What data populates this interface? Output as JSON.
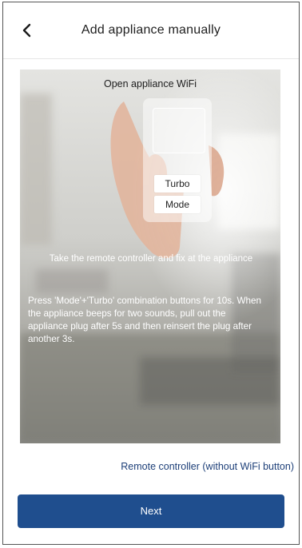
{
  "header": {
    "title": "Add appliance manually"
  },
  "hero": {
    "title": "Open appliance WiFi",
    "remote_buttons": {
      "turbo": "Turbo",
      "mode": "Mode"
    },
    "caption": "Take the remote controller and fix at the appliance",
    "instructions": "Press 'Mode'+'Turbo' combination buttons for 10s. When the appliance beeps for two sounds, pull out the appliance plug after 5s and then reinsert the plug after another 3s."
  },
  "link": {
    "label": "Remote controller (without WiFi button)"
  },
  "footer": {
    "next_label": "Next"
  },
  "colors": {
    "primary_button": "#1f4e8e",
    "link": "#1d3f78",
    "title_text": "#1f1f1f"
  },
  "icons": {
    "back": "chevron-left-icon"
  }
}
